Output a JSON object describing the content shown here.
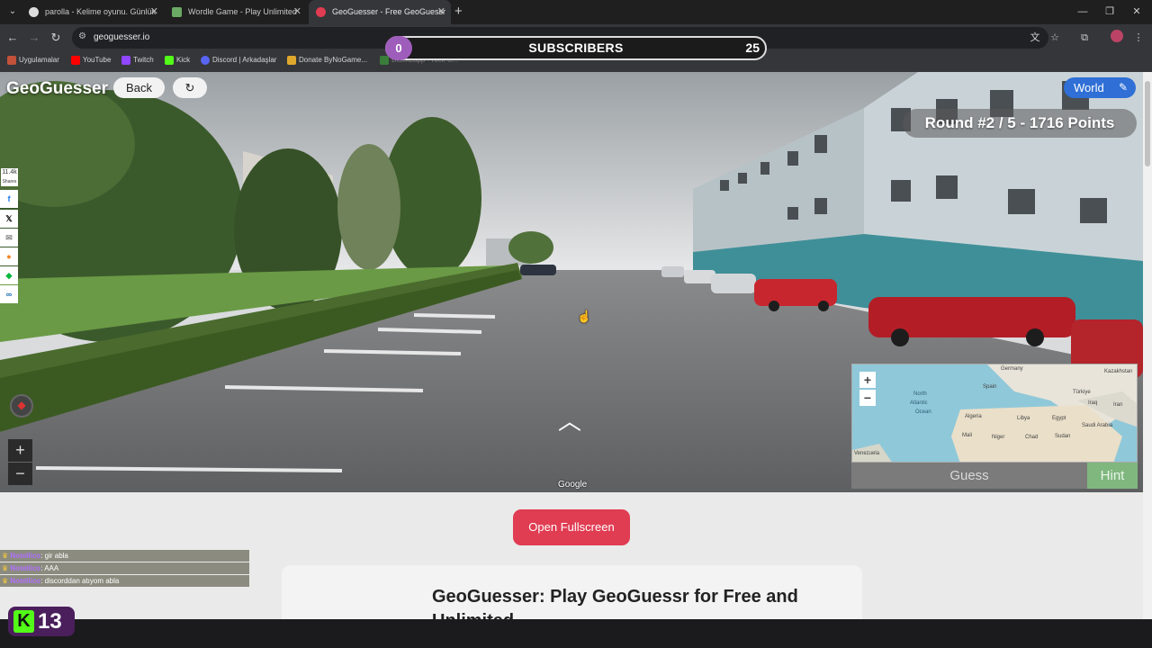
{
  "browser": {
    "tabs": [
      {
        "title": "parolla - Kelime oyunu. Günlük"
      },
      {
        "title": "Wordle Game - Play Unlimited"
      },
      {
        "title": "GeoGuesser - Free GeoGuessr"
      }
    ],
    "url": "geoguesser.io",
    "bookmarks": [
      "Uygulamalar",
      "YouTube",
      "Twitch",
      "Kick",
      "Discord | Arkadaşlar",
      "Donate ByNoGame...",
      "BlackLapp - Kick C..."
    ]
  },
  "subscribers": {
    "label": "SUBSCRIBERS",
    "current": "0",
    "goal": "25"
  },
  "game": {
    "brand": "GeoGuesser",
    "back_label": "Back",
    "world_label": "World",
    "round_info": "Round #2 / 5 - 1716 Points",
    "guess_label": "Guess",
    "hint_label": "Hint",
    "attribution": "Google",
    "share_count": "11.4k",
    "share_label": "Shares"
  },
  "minimap": {
    "labels": [
      "North",
      "Atlantic",
      "Ocean"
    ],
    "countries": [
      "Germany",
      "Spain",
      "Türkiye",
      "Algeria",
      "Libya",
      "Egypt",
      "Iraq",
      "Iran",
      "Mali",
      "Niger",
      "Chad",
      "Sudan",
      "Saudi Arabia",
      "Kazakhstan",
      "Venezuela"
    ]
  },
  "page": {
    "fullscreen_label": "Open Fullscreen",
    "article_title": "GeoGuesser: Play GeoGuessr for Free and Unlimited"
  },
  "chat": [
    {
      "user": "Notellico",
      "message": ": gir abla"
    },
    {
      "user": "Notellico",
      "message": ": AAA"
    },
    {
      "user": "Notellico",
      "message": ": discorddan atıyom abla"
    }
  ],
  "kick": {
    "viewers": "13"
  },
  "colors": {
    "accent_blue": "#2f6fd6",
    "fullscreen_red": "#e03c52",
    "hint_green": "#7fb77e",
    "kick_green": "#53fc18",
    "sub_purple": "#9e5dbb"
  }
}
